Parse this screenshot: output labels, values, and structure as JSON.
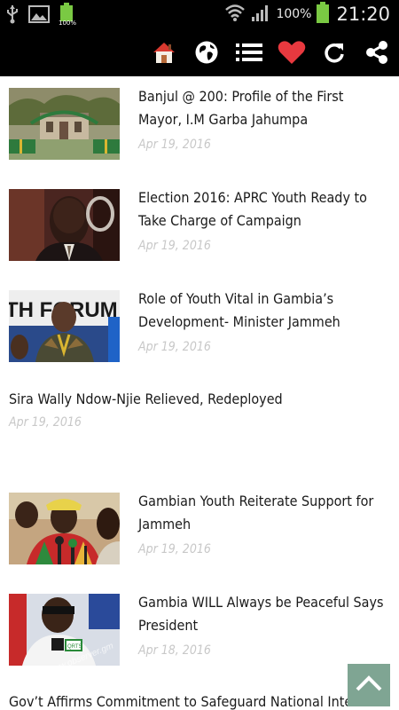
{
  "status_bar": {
    "battery_pct": "100%",
    "mini_battery_label": "100%",
    "time": "21:20"
  },
  "toolbar": {
    "icons": [
      "home-icon",
      "globe-icon",
      "list-icon",
      "heart-icon",
      "refresh-icon",
      "share-icon"
    ]
  },
  "articles": [
    {
      "title": "Banjul @ 200: Profile of the First Mayor, I.M Garba Jahumpa",
      "date": "Apr 19, 2016"
    },
    {
      "title": "Election 2016: APRC Youth Ready to Take Charge of Campaign",
      "date": "Apr 19, 2016"
    },
    {
      "title": "Role of Youth Vital in Gambia’s Development- Minister Jammeh",
      "date": "Apr 19, 2016"
    },
    {
      "title": "Sira Wally Ndow-Njie Relieved, Redeployed",
      "date": "Apr 19, 2016"
    },
    {
      "title": "Gambian Youth Reiterate Support for Jammeh",
      "date": "Apr 19, 2016"
    },
    {
      "title": "Gambia WILL Always be Peaceful Says President",
      "date": "Apr 18, 2016"
    },
    {
      "title": "Gov’t Affirms Commitment to Safeguard National Interest",
      "date": ""
    }
  ],
  "thumb_text": {
    "youth_forum": "TH FORUM",
    "watermark": "www.observer.gm",
    "mic_label": "QRTS"
  },
  "colors": {
    "accent_scroll_button": "#7fa593",
    "date_text": "#c8c8c8",
    "heart": "#e8393f"
  }
}
